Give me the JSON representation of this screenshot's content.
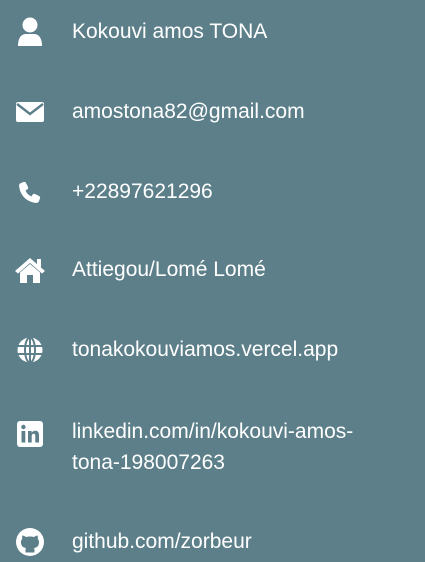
{
  "contact": {
    "name": "Kokouvi amos TONA",
    "email": "amostona82@gmail.com",
    "phone": "+22897621296",
    "address": "Attiegou/Lomé Lomé",
    "website": "tonakokouviamos.vercel.app",
    "linkedin_line1": "linkedin.com/in/kokouvi-amos-",
    "linkedin_line2": "tona-198007263",
    "github": "github.com/zorbeur"
  },
  "icons": {
    "name": "user-icon",
    "email": "envelope-icon",
    "phone": "phone-icon",
    "address": "home-icon",
    "website": "globe-icon",
    "linkedin": "linkedin-icon",
    "github": "github-icon"
  },
  "colors": {
    "background": "#5c7f8a",
    "text": "#ffffff",
    "icon": "#ffffff"
  }
}
